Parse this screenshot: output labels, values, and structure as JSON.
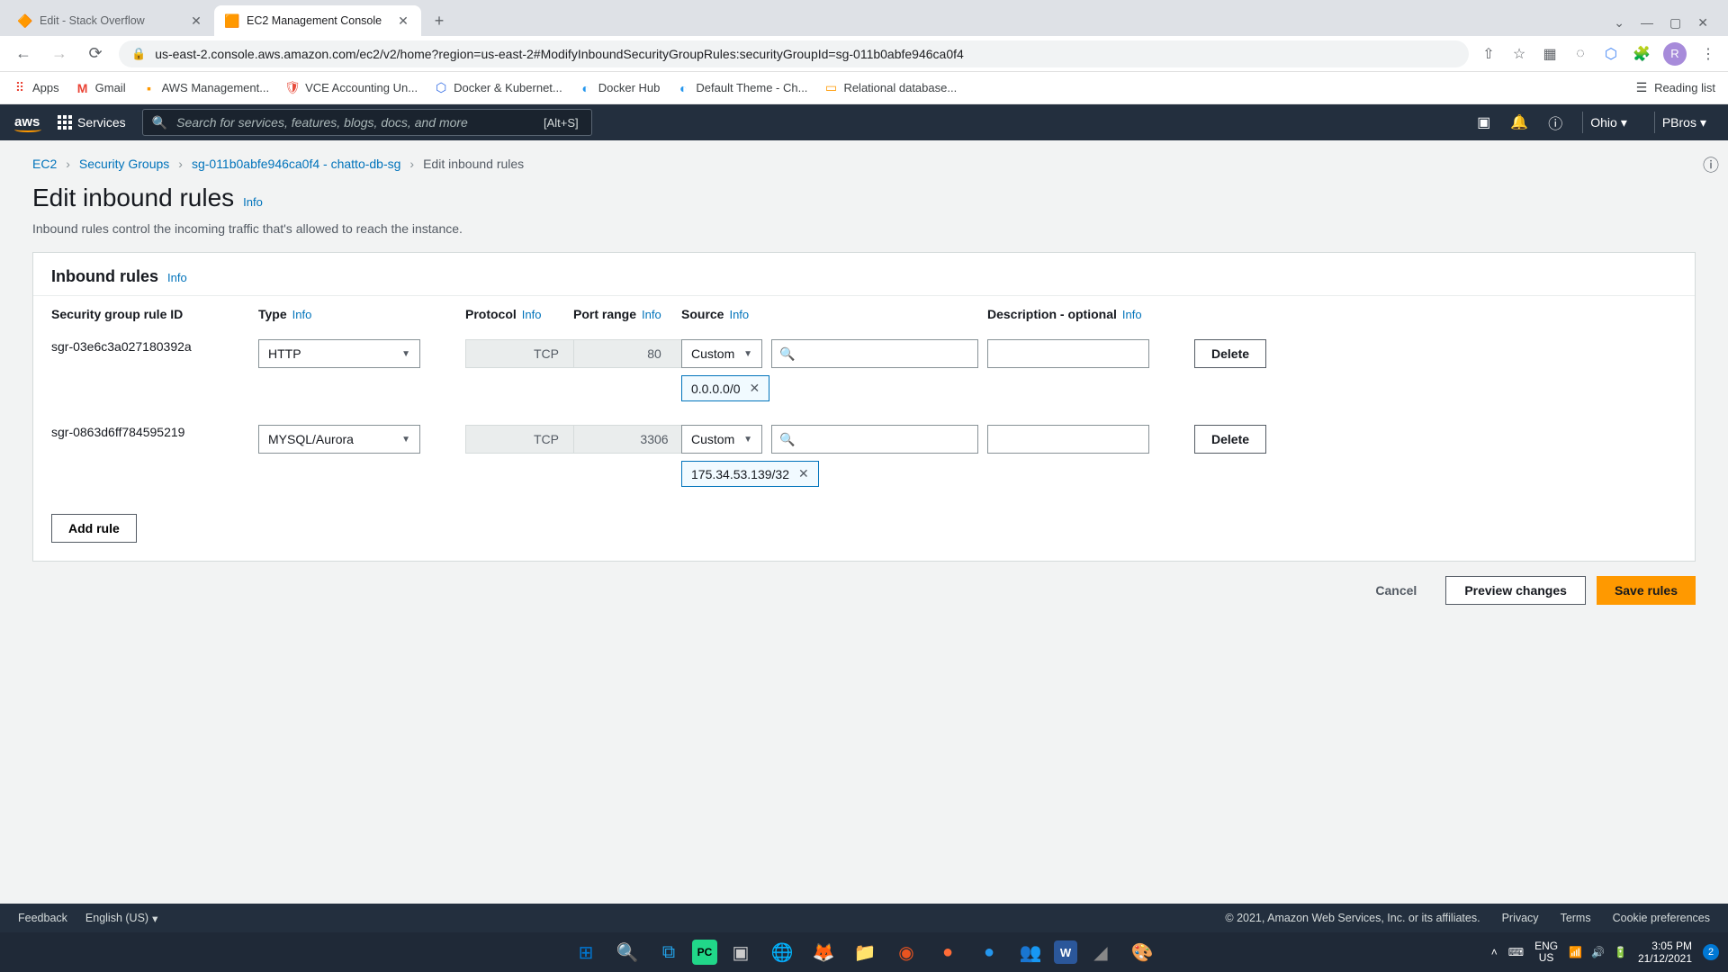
{
  "browser": {
    "tabs": [
      {
        "title": "Edit - Stack Overflow",
        "icon": "🔥",
        "active": false
      },
      {
        "title": "EC2 Management Console",
        "icon": "📦",
        "active": true
      }
    ],
    "url_display": "us-east-2.console.aws.amazon.com/ec2/v2/home?region=us-east-2#ModifyInboundSecurityGroupRules:securityGroupId=sg-011b0abfe946ca0f4",
    "bookmarks": [
      {
        "label": "Apps",
        "icon": "⠿"
      },
      {
        "label": "Gmail",
        "icon": "M"
      },
      {
        "label": "AWS Management...",
        "icon": "📦"
      },
      {
        "label": "VCE Accounting Un...",
        "icon": "🛡"
      },
      {
        "label": "Docker & Kubernet...",
        "icon": "⬇"
      },
      {
        "label": "Docker Hub",
        "icon": "◐"
      },
      {
        "label": "Default Theme - Ch...",
        "icon": "◐"
      },
      {
        "label": "Relational database...",
        "icon": "▭"
      }
    ],
    "reading_list": "Reading list",
    "avatar": "R"
  },
  "aws_header": {
    "services": "Services",
    "search_placeholder": "Search for services, features, blogs, docs, and more",
    "shortcut": "[Alt+S]",
    "region": "Ohio",
    "account": "PBros"
  },
  "breadcrumb": {
    "ec2": "EC2",
    "sg": "Security Groups",
    "sgid": "sg-011b0abfe946ca0f4 - chatto-db-sg",
    "current": "Edit inbound rules"
  },
  "page": {
    "title": "Edit inbound rules",
    "info": "Info",
    "desc": "Inbound rules control the incoming traffic that's allowed to reach the instance."
  },
  "panel": {
    "title": "Inbound rules",
    "info": "Info",
    "columns": {
      "rule_id": "Security group rule ID",
      "type": "Type",
      "protocol": "Protocol",
      "port": "Port range",
      "source": "Source",
      "desc": "Description - optional"
    },
    "rules": [
      {
        "id": "sgr-03e6c3a027180392a",
        "type": "HTTP",
        "protocol": "TCP",
        "port": "80",
        "source_mode": "Custom",
        "source_chip": "0.0.0.0/0"
      },
      {
        "id": "sgr-0863d6ff784595219",
        "type": "MYSQL/Aurora",
        "protocol": "TCP",
        "port": "3306",
        "source_mode": "Custom",
        "source_chip": "175.34.53.139/32"
      }
    ],
    "delete": "Delete",
    "add_rule": "Add rule"
  },
  "actions": {
    "cancel": "Cancel",
    "preview": "Preview changes",
    "save": "Save rules"
  },
  "aws_footer": {
    "feedback": "Feedback",
    "language": "English (US)",
    "copyright": "© 2021, Amazon Web Services, Inc. or its affiliates.",
    "privacy": "Privacy",
    "terms": "Terms",
    "cookie": "Cookie preferences"
  },
  "taskbar": {
    "lang1": "ENG",
    "lang2": "US",
    "time": "3:05 PM",
    "date": "21/12/2021",
    "notif": "2"
  }
}
